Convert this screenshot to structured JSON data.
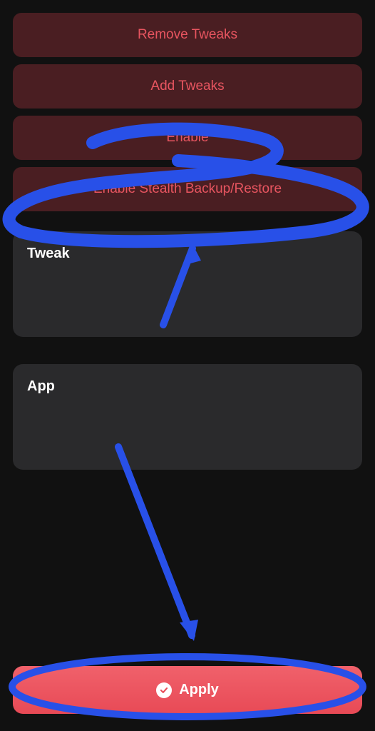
{
  "buttons": {
    "remove_tweaks": "Remove Tweaks",
    "add_tweaks": "Add Tweaks",
    "enable_hidden": "Enable",
    "enable_stealth": "Enable Stealth Backup/Restore",
    "apply": "Apply"
  },
  "sections": {
    "tweak": "Tweak",
    "app": "App"
  },
  "colors": {
    "background": "#111111",
    "button_bg": "#4a1e22",
    "button_text": "#e85560",
    "card_bg": "#2a2a2c",
    "apply_bg": "#e84a56",
    "annotation": "#2850e8"
  }
}
